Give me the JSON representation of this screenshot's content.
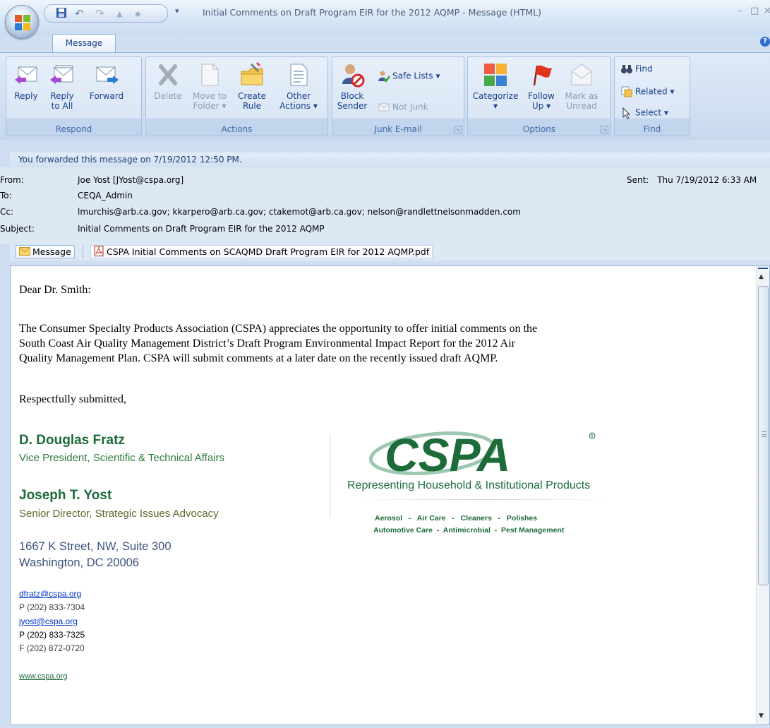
{
  "window": {
    "title": "Initial Comments on Draft Program EIR for the 2012 AQMP - Message (HTML)"
  },
  "ribbon": {
    "tabs": [
      {
        "label": "Message"
      }
    ],
    "groups": {
      "respond": {
        "label": "Respond",
        "reply": "Reply",
        "reply_all_1": "Reply",
        "reply_all_2": "to All",
        "forward": "Forward"
      },
      "actions": {
        "label": "Actions",
        "delete": "Delete",
        "move_1": "Move to",
        "move_2": "Folder",
        "create_1": "Create",
        "create_2": "Rule",
        "other_1": "Other",
        "other_2": "Actions"
      },
      "junk": {
        "label": "Junk E-mail",
        "block_1": "Block",
        "block_2": "Sender",
        "safe_lists": "Safe Lists",
        "not_junk": "Not Junk"
      },
      "options": {
        "label": "Options",
        "categorize": "Categorize",
        "follow_1": "Follow",
        "follow_2": "Up",
        "mark_1": "Mark as",
        "mark_2": "Unread"
      },
      "find": {
        "label": "Find",
        "find": "Find",
        "related": "Related",
        "select": "Select"
      }
    }
  },
  "infobar": {
    "text": "You forwarded this message on 7/19/2012 12:50 PM."
  },
  "header": {
    "from_label": "From:",
    "from_value": "Joe Yost [JYost@cspa.org]",
    "to_label": "To:",
    "to_value": "CEQA_Admin",
    "cc_label": "Cc:",
    "cc_value": "lmurchis@arb.ca.gov; kkarpero@arb.ca.gov; ctakemot@arb.ca.gov; nelson@randlettnelsonmadden.com",
    "subject_label": "Subject:",
    "subject_value": "Initial Comments on Draft Program EIR for the 2012 AQMP",
    "sent_label": "Sent:",
    "sent_value": "Thu 7/19/2012 6:33 AM"
  },
  "attachments": {
    "message_tab": "Message",
    "pdf_name": "CSPA Initial Comments on SCAQMD Draft Program EIR for 2012 AQMP.pdf"
  },
  "body": {
    "salutation": "Dear Dr. Smith:",
    "paragraph_line1": "The Consumer Specialty Products Association (CSPA) appreciates the opportunity to offer initial comments on the",
    "paragraph_line2": "South Coast Air Quality Management District’s Draft Program Environmental Impact Report for the 2012 Air",
    "paragraph_line3": "Quality Management Plan.  CSPA will submit comments at a later date on the recently issued draft AQMP.",
    "closing": "Respectfully submitted,"
  },
  "signature": {
    "person1_name": "D. Douglas Fratz",
    "person1_title": "Vice President, Scientific & Technical Affairs",
    "person2_name": "Joseph T. Yost",
    "person2_title": "Senior Director, Strategic Issues Advocacy",
    "address_line1": "1667 K Street, NW, Suite 300",
    "address_line2": "Washington, DC 20006",
    "email1": "dfratz@cspa.org",
    "phone1": "P (202) 833-7304",
    "email2": "jyost@cspa.org",
    "phone2": "P (202) 833-7325",
    "fax": "F (202) 872-0720",
    "website": "www.cspa.org"
  },
  "logo": {
    "wordmark": "CSPA",
    "tagline": "Representing Household & Institutional Products",
    "categories_line1": "Aerosol   -   Air Care   -   Cleaners   -   Polishes",
    "categories_line2": "Automotive Care  -  Antimicrobial  -  Pest Management",
    "color": "#1e6b3a"
  },
  "colors": {
    "ribbon_text": "#15428b",
    "group_label": "#3e6aaa",
    "accent_green": "#1e6b3a",
    "link_blue": "#0033cc"
  }
}
